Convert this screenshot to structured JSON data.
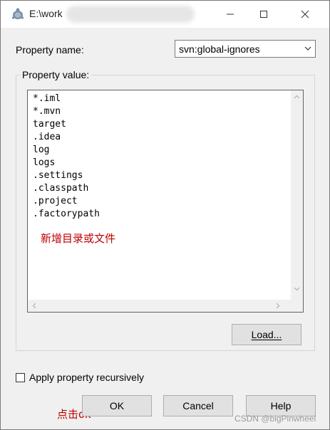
{
  "window": {
    "title": "E:\\work"
  },
  "property_name": {
    "label": "Property name:",
    "selected": "svn:global-ignores"
  },
  "property_value": {
    "legend": "Property value:",
    "lines": [
      "*.iml",
      "*.mvn",
      "target",
      ".idea",
      "log",
      "logs",
      ".settings",
      ".classpath",
      ".project",
      ".factorypath"
    ]
  },
  "annotations": {
    "add_dir": "新增目录或文件",
    "click_ok": "点击ok"
  },
  "buttons": {
    "load": "Load...",
    "ok": "OK",
    "cancel": "Cancel",
    "help": "Help"
  },
  "recursive": {
    "label": "Apply property recursively",
    "checked": false
  },
  "watermark": "CSDN @bigPinwheel",
  "icons": {
    "app": "tortoise-svn-icon",
    "minimize": "minimize-icon",
    "maximize": "maximize-icon",
    "close": "close-icon",
    "dropdown": "chevron-down-icon"
  },
  "colors": {
    "annotation": "#c00000",
    "dialog_bg": "#f0f0f0"
  }
}
